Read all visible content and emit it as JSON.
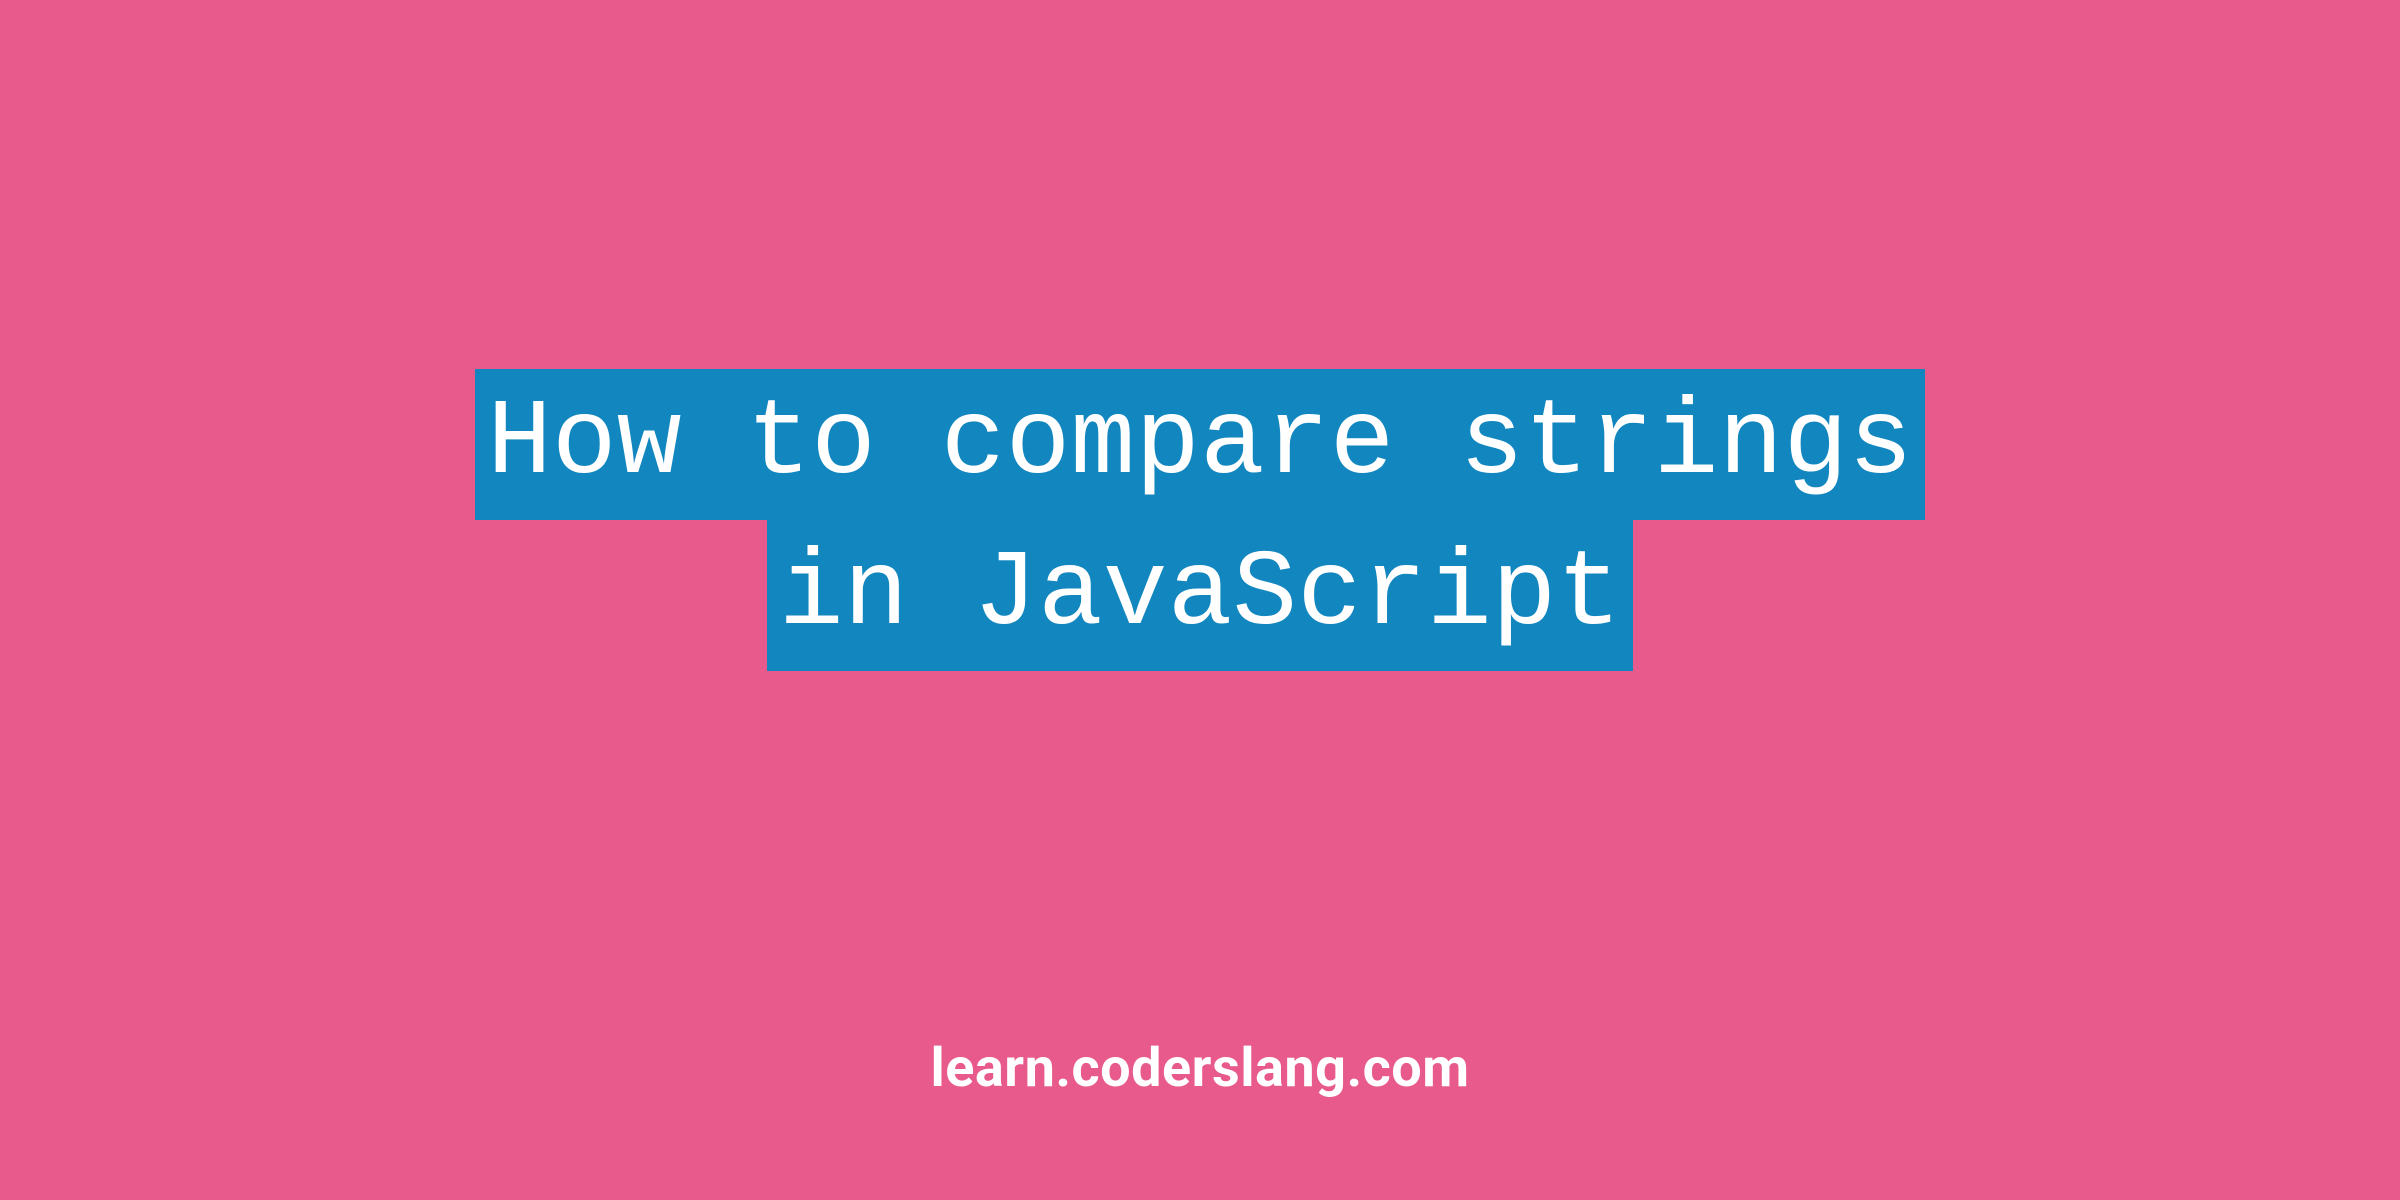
{
  "title": {
    "line1": "How to compare strings",
    "line2": " in JavaScript "
  },
  "footer": "learn.coderslang.com",
  "colors": {
    "background": "#e85a8b",
    "highlight": "#1286bf",
    "text": "#ffffff"
  }
}
